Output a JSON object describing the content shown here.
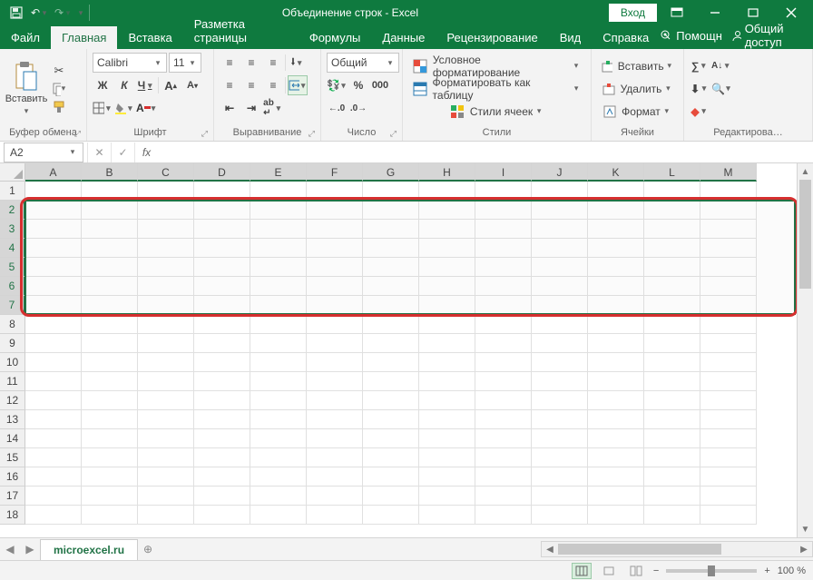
{
  "titlebar": {
    "title": "Объединение строк  -  Excel",
    "login": "Вход"
  },
  "tabs": {
    "items": [
      "Файл",
      "Главная",
      "Вставка",
      "Разметка страницы",
      "Формулы",
      "Данные",
      "Рецензирование",
      "Вид",
      "Справка"
    ],
    "active": 1,
    "help": "Помощн",
    "share": "Общий доступ"
  },
  "ribbon": {
    "clipboard": {
      "label": "Буфер обмена",
      "paste": "Вставить"
    },
    "font": {
      "label": "Шрифт",
      "name": "Calibri",
      "size": "11"
    },
    "align": {
      "label": "Выравнивание"
    },
    "number": {
      "label": "Число",
      "format": "Общий"
    },
    "styles": {
      "label": "Стили",
      "cond": "Условное форматирование",
      "table": "Форматировать как таблицу",
      "cell": "Стили ячеек"
    },
    "cells": {
      "label": "Ячейки",
      "insert": "Вставить",
      "delete": "Удалить",
      "format": "Формат"
    },
    "editing": {
      "label": "Редактирова…"
    }
  },
  "formula": {
    "cellref": "A2"
  },
  "grid": {
    "cols": [
      "A",
      "B",
      "C",
      "D",
      "E",
      "F",
      "G",
      "H",
      "I",
      "J",
      "K",
      "L",
      "M"
    ],
    "rows": [
      1,
      2,
      3,
      4,
      5,
      6,
      7,
      8,
      9,
      10,
      11,
      12,
      13,
      14,
      15,
      16,
      17,
      18
    ],
    "sel_rows": [
      2,
      3,
      4,
      5,
      6,
      7
    ]
  },
  "sheet": {
    "name": "microexcel.ru"
  },
  "status": {
    "zoom": "100 %"
  }
}
